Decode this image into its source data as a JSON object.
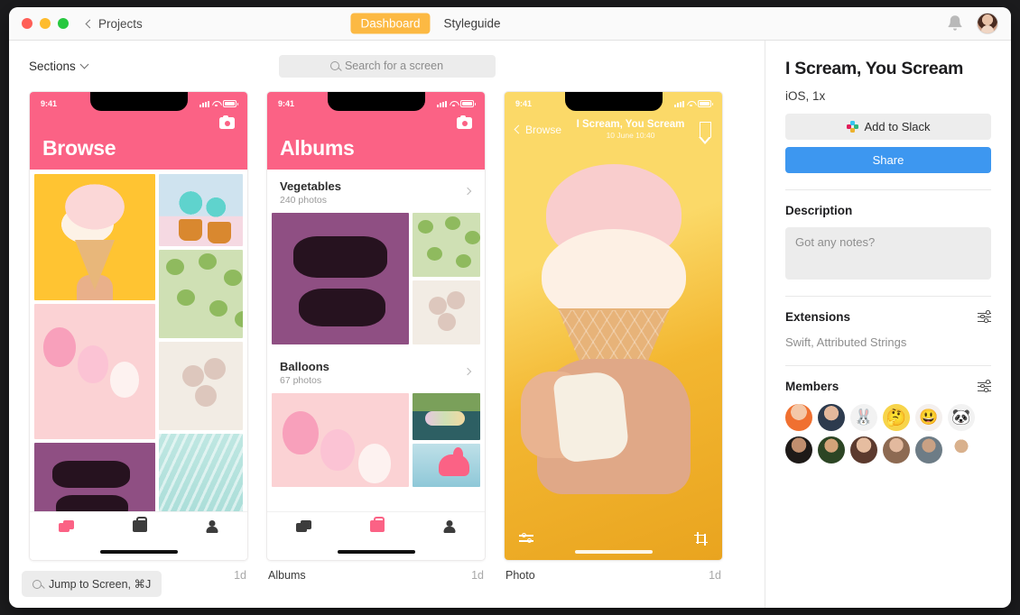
{
  "titlebar": {
    "back_label": "Projects",
    "tabs": [
      {
        "label": "Dashboard",
        "active": true
      },
      {
        "label": "Styleguide",
        "active": false
      }
    ],
    "accent_color": "#fcb943",
    "icons": [
      "bell-icon",
      "user-avatar"
    ]
  },
  "toolbar": {
    "sections_label": "Sections",
    "search_placeholder": "Search for a screen"
  },
  "screens": [
    {
      "label": "Browse",
      "age": "1d",
      "status_time": "9:41",
      "header_title": "Browse",
      "header_color": "#fb6285",
      "tabs": [
        "stack-icon",
        "case-icon",
        "person-icon"
      ],
      "active_tab": 0
    },
    {
      "label": "Albums",
      "age": "1d",
      "status_time": "9:41",
      "header_title": "Albums",
      "header_color": "#fb6285",
      "albums": [
        {
          "name": "Vegetables",
          "count": "240 photos"
        },
        {
          "name": "Balloons",
          "count": "67 photos"
        }
      ],
      "tabs": [
        "stack-icon",
        "case-icon",
        "person-icon"
      ],
      "active_tab": 1
    },
    {
      "label": "Photo",
      "age": "1d",
      "status_time": "9:41",
      "nav_back": "Browse",
      "nav_title": "I Scream, You Scream",
      "nav_subtitle": "10 June  10:40"
    }
  ],
  "jump": {
    "label": "Jump to Screen, ⌘J"
  },
  "sidebar": {
    "title": "I Scream, You Scream",
    "meta": "iOS, 1x",
    "slack_button": "Add to Slack",
    "share_button": "Share",
    "share_color": "#3d97f0",
    "description_heading": "Description",
    "description_placeholder": "Got any notes?",
    "extensions_heading": "Extensions",
    "extensions_value": "Swift, Attributed Strings",
    "members_heading": "Members",
    "members_count": 12
  }
}
